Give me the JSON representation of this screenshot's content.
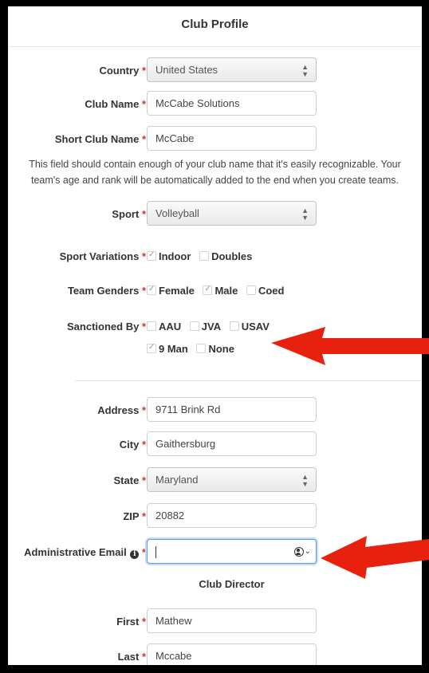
{
  "header": {
    "title": "Club Profile"
  },
  "form": {
    "required_mark": "*",
    "country": {
      "label": "Country",
      "value": "United States"
    },
    "club_name": {
      "label": "Club Name",
      "value": "McCabe Solutions"
    },
    "short_club_name": {
      "label": "Short Club Name",
      "value": "McCabe"
    },
    "help_text": {
      "line1": "This field should contain enough of your club name that it's easily recognizable. Your",
      "line2": "team's age and rank will be automatically added to the end when you create teams."
    },
    "sport": {
      "label": "Sport",
      "value": "Volleyball"
    },
    "sport_variations": {
      "label": "Sport Variations",
      "options": [
        {
          "label": "Indoor",
          "checked": true
        },
        {
          "label": "Doubles",
          "checked": false
        }
      ]
    },
    "team_genders": {
      "label": "Team Genders",
      "options": [
        {
          "label": "Female",
          "checked": true
        },
        {
          "label": "Male",
          "checked": true
        },
        {
          "label": "Coed",
          "checked": false
        }
      ]
    },
    "sanctioned_by": {
      "label": "Sanctioned By",
      "options": [
        {
          "label": "AAU",
          "checked": false
        },
        {
          "label": "JVA",
          "checked": false
        },
        {
          "label": "USAV",
          "checked": false
        },
        {
          "label": "9 Man",
          "checked": true
        },
        {
          "label": "None",
          "checked": false
        }
      ]
    },
    "address": {
      "label": "Address",
      "value": "9711 Brink Rd"
    },
    "city": {
      "label": "City",
      "value": "Gaithersburg"
    },
    "state": {
      "label": "State",
      "value": "Maryland"
    },
    "zip": {
      "label": "ZIP",
      "value": "20882"
    },
    "admin_email": {
      "label": "Administrative Email",
      "value": ""
    },
    "club_director": {
      "title": "Club Director",
      "first": {
        "label": "First",
        "value": "Mathew"
      },
      "last": {
        "label": "Last",
        "value": "Mccabe"
      }
    }
  },
  "colors": {
    "required": "#d9302c",
    "focus": "#5b9be6",
    "annotation_arrow": "#e8210f"
  },
  "icons": {
    "select_arrows": "up-down-arrows-icon",
    "info": "info-icon",
    "autofill": "contact-autofill-icon"
  }
}
